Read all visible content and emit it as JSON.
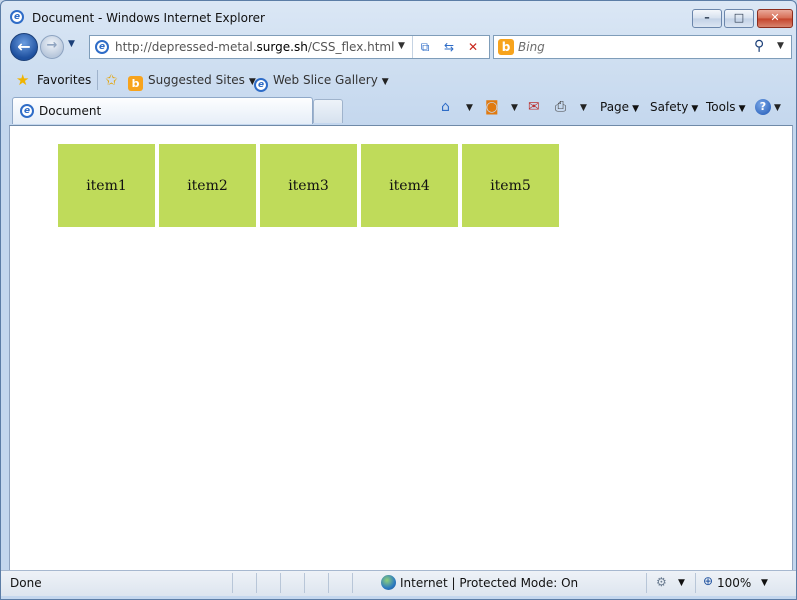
{
  "window": {
    "title": "Document - Windows Internet Explorer",
    "min_label": "–",
    "max_label": "□",
    "close_label": "✕"
  },
  "nav": {
    "address": {
      "url_prefix": "http://depressed-metal.",
      "url_domain": "surge.sh",
      "url_path": "/CSS_flex.html"
    },
    "search": {
      "placeholder": "Bing"
    }
  },
  "favorites_bar": {
    "favorites_label": "Favorites",
    "items": [
      {
        "label": "Suggested Sites"
      },
      {
        "label": "Web Slice Gallery"
      }
    ]
  },
  "tab": {
    "title": "Document"
  },
  "command_bar": {
    "page_label": "Page",
    "safety_label": "Safety",
    "tools_label": "Tools"
  },
  "content": {
    "flex_items": [
      "item1",
      "item2",
      "item3",
      "item4",
      "item5"
    ],
    "item_color": "#bfdb5a"
  },
  "status_bar": {
    "status": "Done",
    "zone": "Internet | Protected Mode: On",
    "zoom": "100%"
  }
}
